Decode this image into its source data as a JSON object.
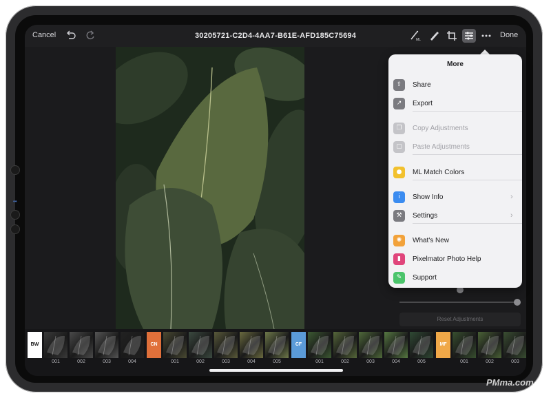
{
  "topbar": {
    "cancel_label": "Cancel",
    "title": "30205721-C2D4-4AA7-B61E-AFD185C75694",
    "done_label": "Done",
    "tools": [
      "ml-enhance-icon",
      "brush-icon",
      "crop-icon",
      "adjustments-icon",
      "more-icon"
    ]
  },
  "popover": {
    "title": "More",
    "items": [
      {
        "label": "Share",
        "icon": "share-icon",
        "color": "#7b7b80",
        "enabled": true
      },
      {
        "label": "Export",
        "icon": "export-icon",
        "color": "#7b7b80",
        "enabled": true
      },
      {
        "label": "Copy Adjustments",
        "icon": "copy-icon",
        "color": "#c4c4c8",
        "enabled": false
      },
      {
        "label": "Paste Adjustments",
        "icon": "paste-icon",
        "color": "#c4c4c8",
        "enabled": false
      },
      {
        "label": "ML Match Colors",
        "icon": "ml-match-icon",
        "color": "#f2c12e",
        "enabled": true
      },
      {
        "label": "Show Info",
        "icon": "info-icon",
        "color": "#3b8cf0",
        "enabled": true,
        "chevron": true
      },
      {
        "label": "Settings",
        "icon": "wrench-icon",
        "color": "#7b7b80",
        "enabled": true,
        "chevron": true
      },
      {
        "label": "What's New",
        "icon": "sparkle-icon",
        "color": "#f2a23a",
        "enabled": true
      },
      {
        "label": "Pixelmator Photo Help",
        "icon": "book-icon",
        "color": "#e0457b",
        "enabled": true
      },
      {
        "label": "Support",
        "icon": "support-icon",
        "color": "#4bc46b",
        "enabled": true
      }
    ]
  },
  "panel": {
    "reset_label": "Reset Adjustments"
  },
  "filmstrip": {
    "categories": [
      {
        "code": "BW",
        "color": "#ffffff",
        "text_color": "#111111",
        "thumbs": [
          "001",
          "002",
          "003",
          "004"
        ]
      },
      {
        "code": "CN",
        "color": "#e0703a",
        "text_color": "#ffffff",
        "thumbs": [
          "001",
          "002",
          "003",
          "004",
          "005"
        ]
      },
      {
        "code": "CF",
        "color": "#5b9bd8",
        "text_color": "#ffffff",
        "thumbs": [
          "001",
          "002",
          "003",
          "004",
          "005"
        ]
      },
      {
        "code": "MF",
        "color": "#f0a848",
        "text_color": "#ffffff",
        "thumbs": [
          "001",
          "002",
          "003"
        ]
      }
    ]
  },
  "watermark": "PMma.com"
}
